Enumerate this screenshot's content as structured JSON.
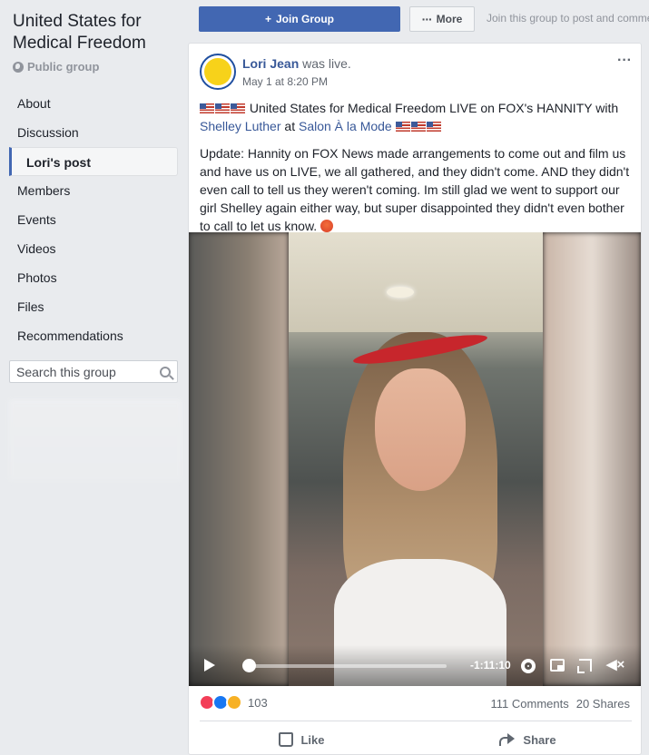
{
  "sidebar": {
    "group_title": "United States for Medical Freedom",
    "group_type": "Public group",
    "nav": [
      {
        "label": "About"
      },
      {
        "label": "Discussion"
      },
      {
        "label": "Lori's post"
      },
      {
        "label": "Members"
      },
      {
        "label": "Events"
      },
      {
        "label": "Videos"
      },
      {
        "label": "Photos"
      },
      {
        "label": "Files"
      },
      {
        "label": "Recommendations"
      }
    ],
    "search_placeholder": "Search this group"
  },
  "topbar": {
    "join_label": "Join Group",
    "more_label": "More",
    "join_hint": "Join this group to post and comment."
  },
  "post": {
    "author": "Lori Jean",
    "action": "was live.",
    "time": "May 1 at 8:20 PM",
    "headline_text": " United States for Medical Freedom LIVE on FOX's HANNITY with ",
    "tag_person": "Shelley Luther",
    "at_word": " at ",
    "tag_place": "Salon À la Mode",
    "body": "Update: Hannity on FOX News made arrangements to come out and film us and have us on LIVE, we all gathered, and they didn't come. AND they didn't even call to tell us they weren't coming. Im still glad we went to support our girl Shelley again either way, but super disappointed they didn't even bother to call to let us know. ",
    "video": {
      "time_remaining": "-1:11:10",
      "progress": 0.0
    },
    "reaction_count": "103",
    "comments": "111 Comments",
    "shares": "20 Shares",
    "like_label": "Like",
    "share_label": "Share"
  },
  "colors": {
    "brand_blue": "#4267b2",
    "link_blue": "#385898",
    "page_bg": "#e9ebee"
  }
}
